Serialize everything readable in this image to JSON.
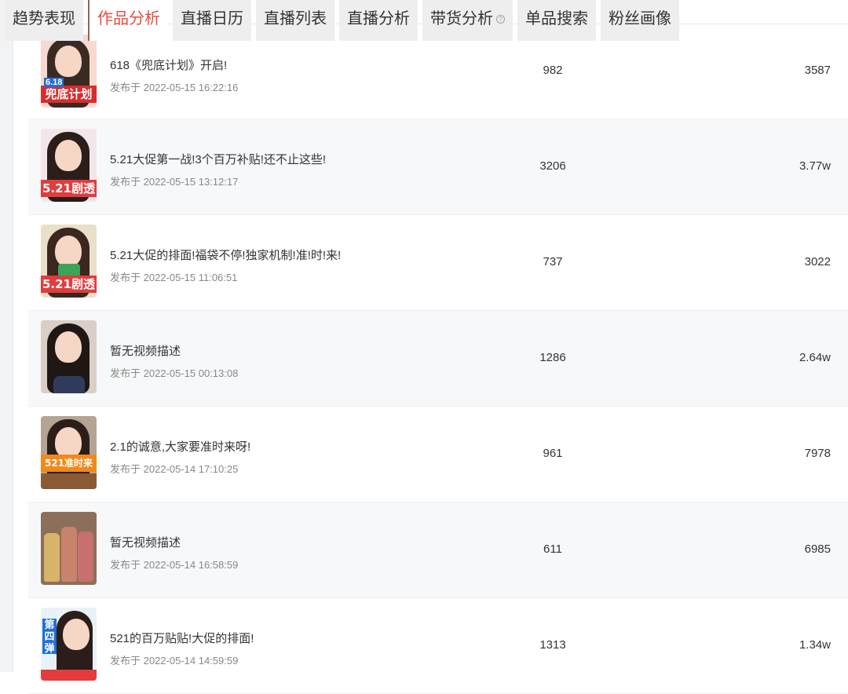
{
  "tabs": [
    {
      "label": "趋势表现"
    },
    {
      "label": "作品分析"
    },
    {
      "label": "直播日历"
    },
    {
      "label": "直播列表"
    },
    {
      "label": "直播分析"
    },
    {
      "label": "带货分析"
    },
    {
      "label": "单品搜索"
    },
    {
      "label": "粉丝画像"
    }
  ],
  "active_tab_index": 1,
  "help_icon_glyph": "?",
  "colors": {
    "active_tab": "#e94b3c",
    "row_alt_bg": "#f7f8fa",
    "tab_bg": "#eeeeee"
  },
  "videos": [
    {
      "title": "618《兜底计划》开启!",
      "date": "发布于 2022-05-15 16:22:16",
      "col1": "982",
      "col2": "3587",
      "thumb_text": "兜底计划",
      "thumb_subtext": "6.18"
    },
    {
      "title": "5.21大促第一战!3个百万补贴!还不止这些!",
      "date": "发布于 2022-05-15 13:12:17",
      "col1": "3206",
      "col2": "3.77w",
      "thumb_text": "5.21剧透"
    },
    {
      "title": "5.21大促的排面!福袋不停!独家机制!准!时!来!",
      "date": "发布于 2022-05-15 11:06:51",
      "col1": "737",
      "col2": "3022",
      "thumb_text": "5.21剧透"
    },
    {
      "title": "暂无视频描述",
      "date": "发布于 2022-05-15 00:13:08",
      "col1": "1286",
      "col2": "2.64w",
      "thumb_text": ""
    },
    {
      "title": "2.1的诚意,大家要准时来呀!",
      "date": "发布于 2022-05-14 17:10:25",
      "col1": "961",
      "col2": "7978",
      "thumb_text": "521准时来"
    },
    {
      "title": "暂无视频描述",
      "date": "发布于 2022-05-14 16:58:59",
      "col1": "611",
      "col2": "6985",
      "thumb_text": ""
    },
    {
      "title": "521的百万贴贴!大促的排面!",
      "date": "发布于 2022-05-14 14:59:59",
      "col1": "1313",
      "col2": "1.34w",
      "thumb_text": "第四弹"
    }
  ]
}
